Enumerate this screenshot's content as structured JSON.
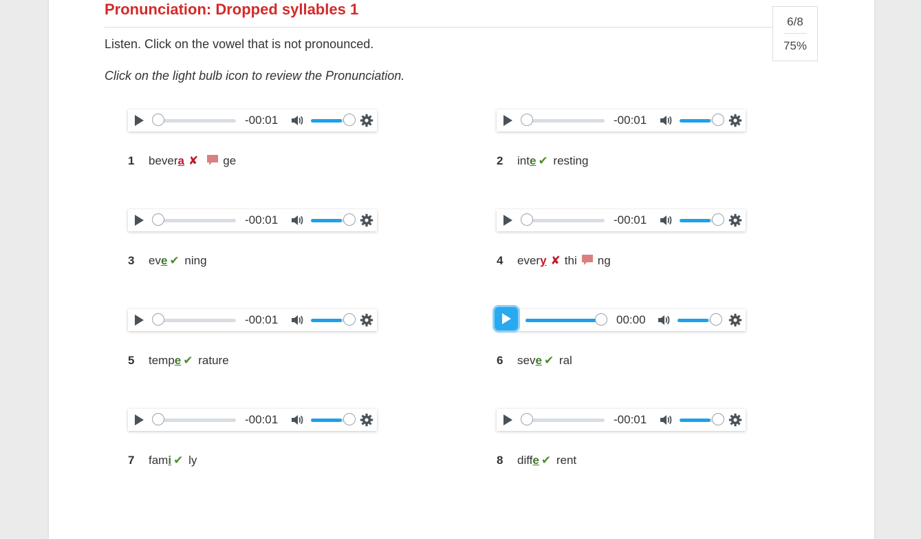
{
  "header": {
    "title": "Pronunciation: Dropped syllables 1",
    "score_fraction": "6/8",
    "score_percent": "75%"
  },
  "instructions": {
    "line1": "Listen. Click on the vowel that is not pronounced.",
    "line2": "Click on the light bulb icon to review the Pronunciation."
  },
  "players": [
    {
      "time": "-00:01",
      "progress": 0,
      "volume": 0.8
    },
    {
      "time": "-00:01",
      "progress": 0,
      "volume": 0.8
    },
    {
      "time": "-00:01",
      "progress": 0,
      "volume": 0.8
    },
    {
      "time": "-00:01",
      "progress": 0,
      "volume": 0.8
    },
    {
      "time": "-00:01",
      "progress": 0,
      "volume": 0.8
    },
    {
      "time": "00:00",
      "progress": 1,
      "volume": 0.8
    },
    {
      "time": "-00:01",
      "progress": 0,
      "volume": 0.8
    },
    {
      "time": "-00:01",
      "progress": 0,
      "volume": 0.8
    }
  ],
  "items": [
    {
      "num": "1",
      "pre": "bever",
      "vowel": "a",
      "post": "ge",
      "correct": false,
      "extra": ""
    },
    {
      "num": "2",
      "pre": "int",
      "vowel": "e",
      "post": "resting",
      "correct": true,
      "extra": ""
    },
    {
      "num": "3",
      "pre": "ev",
      "vowel": "e",
      "post": "ning",
      "correct": true,
      "extra": ""
    },
    {
      "num": "4",
      "pre": "ever",
      "vowel": "y",
      "post": "ng",
      "correct": false,
      "extra": "thi"
    },
    {
      "num": "5",
      "pre": "temp",
      "vowel": "e",
      "post": "rature",
      "correct": true,
      "extra": ""
    },
    {
      "num": "6",
      "pre": "sev",
      "vowel": "e",
      "post": "ral",
      "correct": true,
      "extra": ""
    },
    {
      "num": "7",
      "pre": "fam",
      "vowel": "i",
      "post": "ly",
      "correct": true,
      "extra": ""
    },
    {
      "num": "8",
      "pre": "diff",
      "vowel": "e",
      "post": "rent",
      "correct": true,
      "extra": ""
    }
  ],
  "marks": {
    "check": "✔",
    "cross": "✘"
  },
  "colors": {
    "title": "#d42a2a",
    "accent": "#1ea0eb",
    "correct": "#4d8f2f",
    "wrong": "#c0182b"
  },
  "icons": {
    "play": "play-icon",
    "volume": "volume-icon",
    "settings": "gear-icon",
    "feedback": "speech-bubble-icon"
  }
}
